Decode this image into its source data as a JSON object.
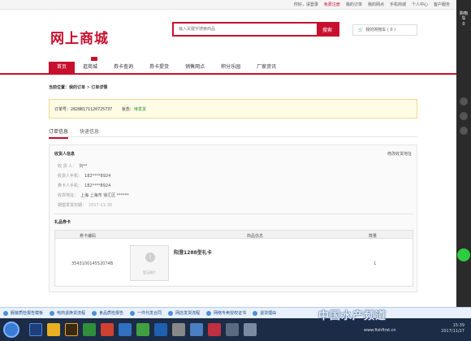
{
  "topbar": {
    "links": [
      "你好，请登录",
      "免费注册",
      "我的订单",
      "我的网点",
      "手机商城",
      "个人中心",
      "客户服务"
    ]
  },
  "rightbar": {
    "cart_label": "购物车",
    "cart_count": "0"
  },
  "header": {
    "logo": "网上商城",
    "search_placeholder": "输入关键字搜索商品",
    "search_button": "搜索",
    "cart_label": "我的购物车 ( 0 )"
  },
  "nav": [
    "首页",
    "逛商城",
    "券卡查询",
    "券卡提货",
    "销售网点",
    "积分乐园",
    "厂家资讯"
  ],
  "breadcrumb": {
    "label": "当前位置：",
    "link": "我的订单",
    "sep": " > ",
    "current": "订单详情"
  },
  "order": {
    "num_label": "订单号：",
    "num": "2828B171120725737",
    "status_label": "状态：",
    "status": "待发货"
  },
  "tabs": [
    "订单信息",
    "快递信息"
  ],
  "receiver": {
    "title": "收货人信息",
    "edit_link": "修改收货地址",
    "rows": [
      {
        "label": "收 货 人：",
        "value": "刘**"
      },
      {
        "label": "收货人手机：",
        "value": "182****8924"
      },
      {
        "label": "券卡人手机：",
        "value": "182****8924"
      },
      {
        "label": "收货地址：",
        "value": "上海 上海市 徐汇区 ******"
      },
      {
        "label": "期望发货日期：",
        "value": "2017-11-30"
      }
    ]
  },
  "gift": {
    "title": "礼品券卡",
    "headers": [
      "券卡编码",
      "商品信息",
      "数量"
    ],
    "row": {
      "code": "354310014552074B",
      "thumb_caption": "暂无图片",
      "name": "阳澄1288型礼卡",
      "qty": "1"
    }
  },
  "quickbar": [
    "服装质检报告模板",
    "电商退换货流程",
    "食品质检报告",
    "一件代发合同",
    "网店发货流程",
    "网络专卖授权证书",
    "退货理由"
  ],
  "watermark": {
    "text": "中国水产频道",
    "url": "www.fishfirst.cn"
  },
  "clock": {
    "time": "15:39",
    "date": "2017/11/27"
  }
}
